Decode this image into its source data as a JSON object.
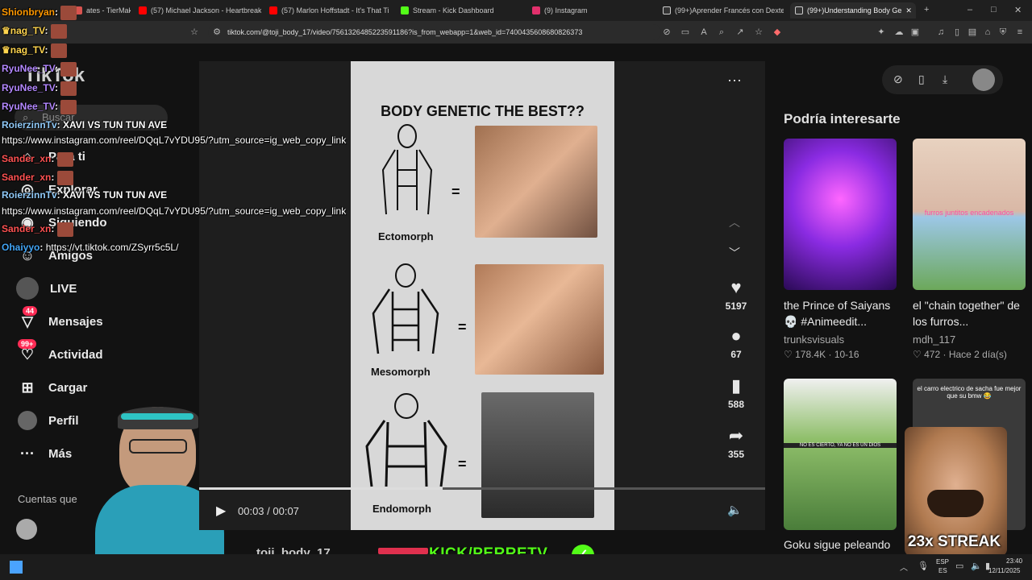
{
  "browser": {
    "tabs": [
      {
        "label": "ates - TierMak",
        "icon_color": "#d9534f"
      },
      {
        "label": "(57) Michael Jackson - Heartbreak H",
        "icon_color": "#ff0000"
      },
      {
        "label": "(57) Marlon Hoffstadt - It's That Tim",
        "icon_color": "#ff0000"
      },
      {
        "label": "Stream - Kick Dashboard",
        "icon_color": "#53fc18"
      },
      {
        "label": "(9) Instagram",
        "icon_color": "#e1306c"
      },
      {
        "label": "(99+)Aprender Francés con Dexter",
        "icon_color": "#ffffff"
      },
      {
        "label": "(99+)Understanding Body Ge",
        "icon_color": "#ffffff"
      }
    ],
    "url": "tiktok.com/@toji_body_17/video/7561326485223591186?is_from_webapp=1&web_id=7400435608680826373",
    "window_controls": {
      "minimize": "–",
      "maximize": "□",
      "close": "✕"
    },
    "new_tab": "+"
  },
  "tiktok": {
    "logo_text": "TikTok",
    "search_placeholder": "Buscar",
    "nav": [
      {
        "label": "Para ti",
        "icon": "home-icon"
      },
      {
        "label": "Explorar",
        "icon": "compass-icon"
      },
      {
        "label": "Siguiendo",
        "icon": "following-icon"
      },
      {
        "label": "Amigos",
        "icon": "friends-icon"
      },
      {
        "label": "LIVE",
        "icon": "live-icon"
      },
      {
        "label": "Mensajes",
        "icon": "messages-icon",
        "badge": "44"
      },
      {
        "label": "Actividad",
        "icon": "activity-icon",
        "badge": "99+"
      },
      {
        "label": "Cargar",
        "icon": "upload-icon"
      },
      {
        "label": "Perfil",
        "icon": "profile-icon"
      },
      {
        "label": "Más",
        "icon": "more-icon"
      }
    ],
    "following_header": "Cuentas que"
  },
  "chat": [
    {
      "user": "Shionbryan",
      "color": "#ff9800",
      "text": ""
    },
    {
      "user": "nag_TV",
      "color": "#ffd54f",
      "text": ""
    },
    {
      "user": "nag_TV",
      "color": "#ffd54f",
      "text": ""
    },
    {
      "user": "RyuNee_TV",
      "color": "#b388ff",
      "text": ""
    },
    {
      "user": "RyuNee_TV",
      "color": "#b388ff",
      "text": ""
    },
    {
      "user": "RyuNee_TV",
      "color": "#b388ff",
      "text": ""
    },
    {
      "user": "RoierzinnTv",
      "color": "#90caf9",
      "text": "XAVI VS TUN TUN AVE"
    },
    {
      "user": "",
      "color": "#ffffff",
      "text": "https://www.instagram.com/reel/DQqL7vYDU95/?utm_source=ig_web_copy_link"
    },
    {
      "user": "Sander_xn",
      "color": "#ff5252",
      "text": ""
    },
    {
      "user": "Sander_xn",
      "color": "#ff5252",
      "text": ""
    },
    {
      "user": "RoierzinnTv",
      "color": "#90caf9",
      "text": "XAVI VS TUN TUN AVE"
    },
    {
      "user": "",
      "color": "#ffffff",
      "text": "https://www.instagram.com/reel/DQqL7vYDU95/?utm_source=ig_web_copy_link"
    },
    {
      "user": "Sander_xn",
      "color": "#ff5252",
      "text": ""
    },
    {
      "user": "Ohaiyyo",
      "color": "#42a5f5",
      "text": "https://vt.tiktok.com/ZSyrr5c5L/"
    }
  ],
  "video": {
    "title": "BODY GENETIC THE BEST??",
    "rows": [
      {
        "label": "Ectomorph"
      },
      {
        "label": "Mesomorph"
      },
      {
        "label": "Endomorph"
      }
    ],
    "equals": "=",
    "time": "00:03 / 00:07",
    "progress": 0.43
  },
  "actions": {
    "likes": "5197",
    "comments": "67",
    "saves": "588",
    "shares": "355"
  },
  "author_handle": "toji_body_17",
  "stream_overlay": {
    "brand": "KICK/PERRETV",
    "streak": "23x STREAK"
  },
  "recommendations": {
    "header": "Podría interesarte",
    "cards": [
      {
        "title": "the Prince of Saiyans 💀 #Animeedit...",
        "author": "trunksvisuals",
        "likes": "178.4K",
        "date": "10-16",
        "thumb_color": "#8a2be2"
      },
      {
        "title": "el \"chain together\" de los furros...",
        "author": "mdh_117",
        "likes": "472",
        "date": "Hace 2 día(s)",
        "thumb_color": "#a9d08e",
        "overlay": "furros juntitos encadenados"
      },
      {
        "title": "Goku sigue peleando",
        "author": "",
        "likes": "",
        "date": "",
        "thumb_color": "#4a7d3a",
        "overlay": "NO ES CIERTO, YA NO ES UN DIOS"
      },
      {
        "title": "",
        "author": "",
        "likes": "",
        "date": "",
        "thumb_color": "#3a3a3a",
        "overlay": "el carro electrico de sacha fue mejor que su bmw 😂"
      }
    ]
  },
  "taskbar": {
    "lang": "ESP",
    "region": "ES",
    "time": "23:40",
    "date": "12/11/2025"
  }
}
